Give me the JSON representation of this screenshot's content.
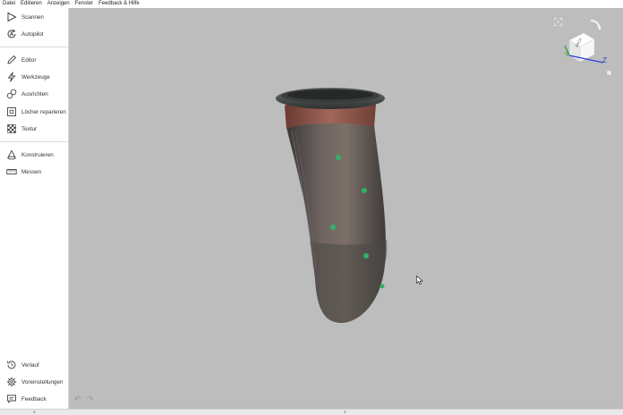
{
  "menubar": {
    "items": [
      "Datei",
      "Editieren",
      "Anzeigen",
      "Fenster",
      "Feedback & Hilfe"
    ]
  },
  "sidebar": {
    "scan": {
      "label": "Scannen",
      "icon": "play-icon"
    },
    "autopilot": {
      "label": "Autopilot",
      "icon": "autopilot-icon"
    },
    "editor": {
      "label": "Editor",
      "icon": "pencil-icon"
    },
    "tools": {
      "label": "Werkzeuge",
      "icon": "lightning-icon"
    },
    "align": {
      "label": "Ausrichten",
      "icon": "align-icon"
    },
    "repair": {
      "label": "Löcher reparieren",
      "icon": "hole-repair-icon"
    },
    "texture": {
      "label": "Textur",
      "icon": "texture-icon"
    },
    "construct": {
      "label": "Konstruieren",
      "icon": "cone-icon"
    },
    "measure": {
      "label": "Messen",
      "icon": "ruler-icon"
    },
    "history": {
      "label": "Verlauf",
      "icon": "history-icon"
    },
    "preferences": {
      "label": "Voreinstellungen",
      "icon": "gear-icon"
    },
    "feedback": {
      "label": "Feedback",
      "icon": "chat-icon"
    }
  },
  "viewport": {
    "background": "#bdbdbd",
    "nav_cube": {
      "face_label": "BACK",
      "axis_x": "X",
      "axis_y": "Y",
      "axis_z": "Z"
    },
    "undo_icon": "↶",
    "redo_icon": "↷"
  },
  "bottombar": {
    "left_mark": "≡",
    "center_mark": "≡"
  },
  "colors": {
    "accent_green": "#2fb36a",
    "axis_blue": "#2b3fd6",
    "axis_green": "#1e9e2a"
  }
}
